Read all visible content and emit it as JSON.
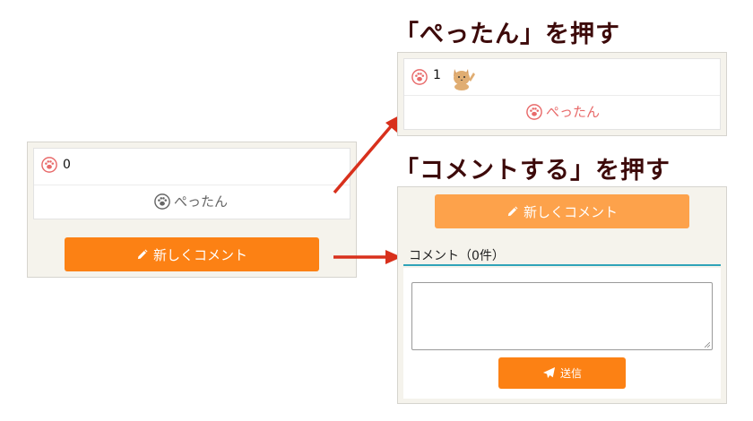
{
  "left_panel": {
    "count": "0",
    "pettan_label": "ぺったん",
    "new_comment_label": "新しくコメント"
  },
  "top_right": {
    "heading": "「ぺったん」を押す",
    "count": "1",
    "pettan_label": "ぺったん"
  },
  "bottom_right": {
    "heading": "「コメントする」を押す",
    "new_comment_label": "新しくコメント",
    "comments_label": "コメント（0件）",
    "send_label": "送信"
  },
  "colors": {
    "accent_orange": "#fc8114",
    "accent_orange_light": "#fda24b",
    "paw_pink": "#e86a6a",
    "paw_gray": "#666666",
    "arrow_red": "#d8301c",
    "teal": "#2fa3b8",
    "heading_color": "#3d0a0a"
  }
}
